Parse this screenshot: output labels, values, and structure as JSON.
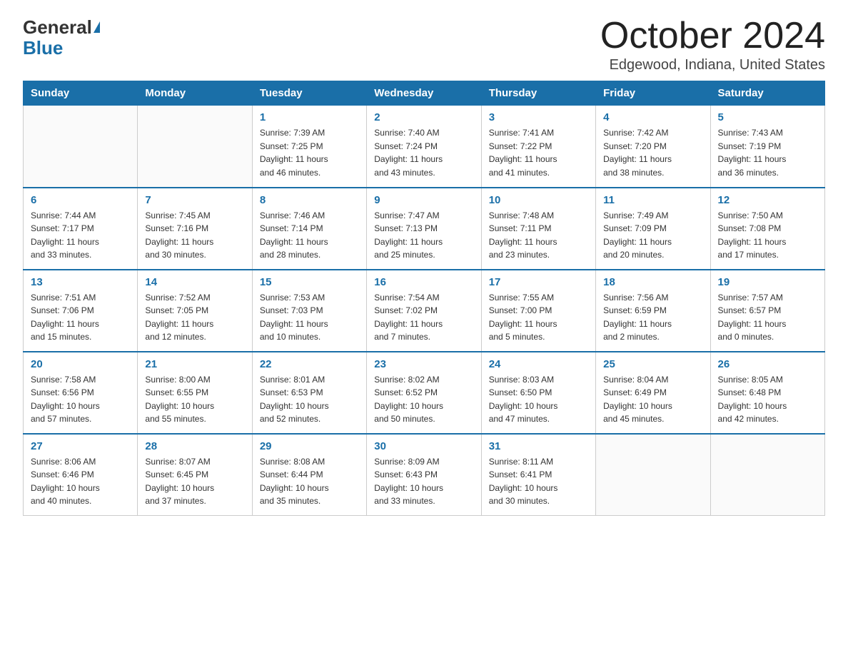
{
  "logo": {
    "general": "General",
    "blue": "Blue"
  },
  "title": {
    "month_year": "October 2024",
    "location": "Edgewood, Indiana, United States"
  },
  "weekdays": [
    "Sunday",
    "Monday",
    "Tuesday",
    "Wednesday",
    "Thursday",
    "Friday",
    "Saturday"
  ],
  "weeks": [
    [
      {
        "day": "",
        "info": ""
      },
      {
        "day": "",
        "info": ""
      },
      {
        "day": "1",
        "info": "Sunrise: 7:39 AM\nSunset: 7:25 PM\nDaylight: 11 hours\nand 46 minutes."
      },
      {
        "day": "2",
        "info": "Sunrise: 7:40 AM\nSunset: 7:24 PM\nDaylight: 11 hours\nand 43 minutes."
      },
      {
        "day": "3",
        "info": "Sunrise: 7:41 AM\nSunset: 7:22 PM\nDaylight: 11 hours\nand 41 minutes."
      },
      {
        "day": "4",
        "info": "Sunrise: 7:42 AM\nSunset: 7:20 PM\nDaylight: 11 hours\nand 38 minutes."
      },
      {
        "day": "5",
        "info": "Sunrise: 7:43 AM\nSunset: 7:19 PM\nDaylight: 11 hours\nand 36 minutes."
      }
    ],
    [
      {
        "day": "6",
        "info": "Sunrise: 7:44 AM\nSunset: 7:17 PM\nDaylight: 11 hours\nand 33 minutes."
      },
      {
        "day": "7",
        "info": "Sunrise: 7:45 AM\nSunset: 7:16 PM\nDaylight: 11 hours\nand 30 minutes."
      },
      {
        "day": "8",
        "info": "Sunrise: 7:46 AM\nSunset: 7:14 PM\nDaylight: 11 hours\nand 28 minutes."
      },
      {
        "day": "9",
        "info": "Sunrise: 7:47 AM\nSunset: 7:13 PM\nDaylight: 11 hours\nand 25 minutes."
      },
      {
        "day": "10",
        "info": "Sunrise: 7:48 AM\nSunset: 7:11 PM\nDaylight: 11 hours\nand 23 minutes."
      },
      {
        "day": "11",
        "info": "Sunrise: 7:49 AM\nSunset: 7:09 PM\nDaylight: 11 hours\nand 20 minutes."
      },
      {
        "day": "12",
        "info": "Sunrise: 7:50 AM\nSunset: 7:08 PM\nDaylight: 11 hours\nand 17 minutes."
      }
    ],
    [
      {
        "day": "13",
        "info": "Sunrise: 7:51 AM\nSunset: 7:06 PM\nDaylight: 11 hours\nand 15 minutes."
      },
      {
        "day": "14",
        "info": "Sunrise: 7:52 AM\nSunset: 7:05 PM\nDaylight: 11 hours\nand 12 minutes."
      },
      {
        "day": "15",
        "info": "Sunrise: 7:53 AM\nSunset: 7:03 PM\nDaylight: 11 hours\nand 10 minutes."
      },
      {
        "day": "16",
        "info": "Sunrise: 7:54 AM\nSunset: 7:02 PM\nDaylight: 11 hours\nand 7 minutes."
      },
      {
        "day": "17",
        "info": "Sunrise: 7:55 AM\nSunset: 7:00 PM\nDaylight: 11 hours\nand 5 minutes."
      },
      {
        "day": "18",
        "info": "Sunrise: 7:56 AM\nSunset: 6:59 PM\nDaylight: 11 hours\nand 2 minutes."
      },
      {
        "day": "19",
        "info": "Sunrise: 7:57 AM\nSunset: 6:57 PM\nDaylight: 11 hours\nand 0 minutes."
      }
    ],
    [
      {
        "day": "20",
        "info": "Sunrise: 7:58 AM\nSunset: 6:56 PM\nDaylight: 10 hours\nand 57 minutes."
      },
      {
        "day": "21",
        "info": "Sunrise: 8:00 AM\nSunset: 6:55 PM\nDaylight: 10 hours\nand 55 minutes."
      },
      {
        "day": "22",
        "info": "Sunrise: 8:01 AM\nSunset: 6:53 PM\nDaylight: 10 hours\nand 52 minutes."
      },
      {
        "day": "23",
        "info": "Sunrise: 8:02 AM\nSunset: 6:52 PM\nDaylight: 10 hours\nand 50 minutes."
      },
      {
        "day": "24",
        "info": "Sunrise: 8:03 AM\nSunset: 6:50 PM\nDaylight: 10 hours\nand 47 minutes."
      },
      {
        "day": "25",
        "info": "Sunrise: 8:04 AM\nSunset: 6:49 PM\nDaylight: 10 hours\nand 45 minutes."
      },
      {
        "day": "26",
        "info": "Sunrise: 8:05 AM\nSunset: 6:48 PM\nDaylight: 10 hours\nand 42 minutes."
      }
    ],
    [
      {
        "day": "27",
        "info": "Sunrise: 8:06 AM\nSunset: 6:46 PM\nDaylight: 10 hours\nand 40 minutes."
      },
      {
        "day": "28",
        "info": "Sunrise: 8:07 AM\nSunset: 6:45 PM\nDaylight: 10 hours\nand 37 minutes."
      },
      {
        "day": "29",
        "info": "Sunrise: 8:08 AM\nSunset: 6:44 PM\nDaylight: 10 hours\nand 35 minutes."
      },
      {
        "day": "30",
        "info": "Sunrise: 8:09 AM\nSunset: 6:43 PM\nDaylight: 10 hours\nand 33 minutes."
      },
      {
        "day": "31",
        "info": "Sunrise: 8:11 AM\nSunset: 6:41 PM\nDaylight: 10 hours\nand 30 minutes."
      },
      {
        "day": "",
        "info": ""
      },
      {
        "day": "",
        "info": ""
      }
    ]
  ]
}
